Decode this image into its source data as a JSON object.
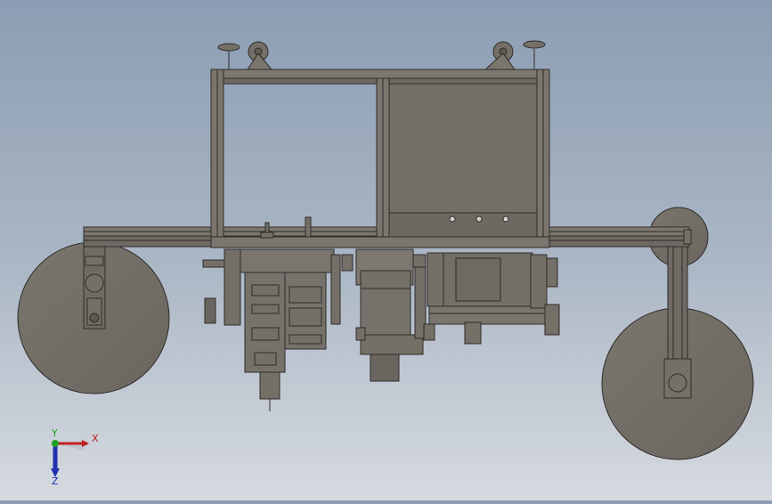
{
  "viewport": {
    "background_top": "#8c9db3",
    "background_bottom": "#d6dae0",
    "part_fill": "#747068",
    "edge_color": "#2f2c29"
  },
  "triad": {
    "x_label": "X",
    "y_label": "Y",
    "z_label": "Z",
    "x_color": "#c02020",
    "y_color": "#20a020",
    "z_color": "#2030b0"
  }
}
